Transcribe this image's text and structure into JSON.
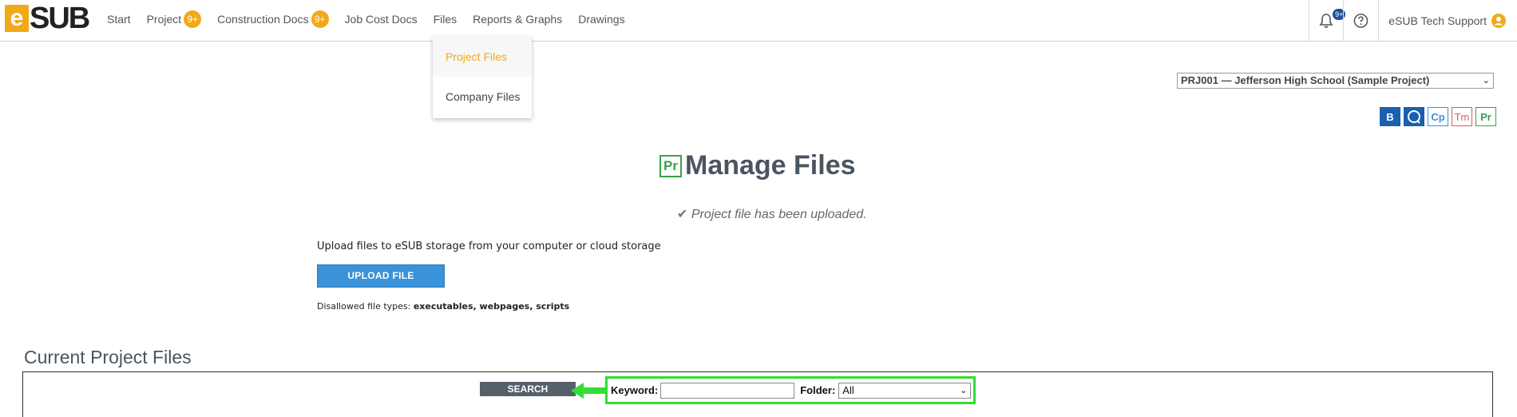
{
  "brand": {
    "logo_e": "e",
    "logo_sub": "SUB",
    "accent": "#f0a91b"
  },
  "nav": {
    "start": "Start",
    "project": "Project",
    "project_badge": "9+",
    "construction_docs": "Construction Docs",
    "construction_badge": "9+",
    "job_cost_docs": "Job Cost Docs",
    "files": "Files",
    "reports": "Reports & Graphs",
    "drawings": "Drawings"
  },
  "header_tools": {
    "notifications_badge": "9+",
    "user_name": "eSUB Tech Support"
  },
  "files_menu": {
    "project_files": "Project Files",
    "company_files": "Company Files"
  },
  "project_select": {
    "value": "PRJ001 — Jefferson High School (Sample Project)"
  },
  "modules": [
    {
      "label": "B",
      "color": "#1b5fb0"
    },
    {
      "label": "Q",
      "color": "#1b5fb0"
    },
    {
      "label": "Cp",
      "color": "#3a93d8"
    },
    {
      "label": "Tm",
      "color": "#e05a5a"
    },
    {
      "label": "Pr",
      "color": "#3aa04a"
    }
  ],
  "page": {
    "title_icon": "Pr",
    "title": "Manage Files",
    "success_message": "Project file has been uploaded.",
    "upload_description": "Upload files to eSUB storage from your computer or cloud storage",
    "upload_button": "UPLOAD FILE",
    "disallowed_label": "Disallowed file types:",
    "disallowed_types": "executables, webpages, scripts",
    "section_title": "Current Project Files"
  },
  "search": {
    "button": "SEARCH",
    "keyword_label": "Keyword:",
    "keyword_value": "",
    "folder_label": "Folder:",
    "folder_value": "All"
  }
}
